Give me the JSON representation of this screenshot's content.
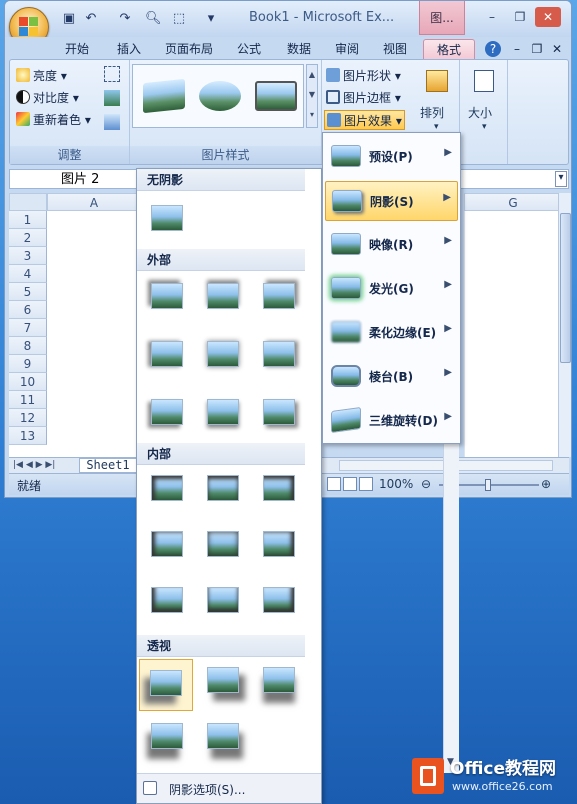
{
  "window": {
    "title": "Book1 - Microsoft Ex...",
    "context_tab": "图...",
    "min": "–",
    "restore": "❐",
    "close": "✕"
  },
  "tabs": [
    "开始",
    "插入",
    "页面布局",
    "公式",
    "数据",
    "审阅",
    "视图",
    "格式"
  ],
  "ribbon": {
    "adjust": {
      "items": [
        "亮度",
        "对比度",
        "重新着色"
      ],
      "label": "调整"
    },
    "styles": {
      "label": "图片样式"
    },
    "picture": {
      "shape": "图片形状",
      "border": "图片边框",
      "effects": "图片效果"
    },
    "arrange": {
      "label": "排列"
    },
    "size": {
      "label": "大小"
    }
  },
  "namebox": "图片 2",
  "grid": {
    "col_a": "A",
    "col_g": "G",
    "rows": [
      "1",
      "2",
      "3",
      "4",
      "5",
      "6",
      "7",
      "8",
      "9",
      "10",
      "11",
      "12",
      "13"
    ]
  },
  "sheet_tab": "Sheet1",
  "status": {
    "ready": "就绪",
    "zoom": "100%"
  },
  "shadow_panel": {
    "sections": [
      "无阴影",
      "外部",
      "内部",
      "透视"
    ],
    "footer": "阴影选项(S)..."
  },
  "effects_menu": [
    {
      "label": "预设(P)"
    },
    {
      "label": "阴影(S)",
      "highlighted": true
    },
    {
      "label": "映像(R)"
    },
    {
      "label": "发光(G)"
    },
    {
      "label": "柔化边缘(E)"
    },
    {
      "label": "棱台(B)"
    },
    {
      "label": "三维旋转(D)"
    }
  ],
  "watermark": {
    "brand": "Office教程网",
    "url": "www.office26.com"
  },
  "colors": {
    "accent": "#ffd66a",
    "context": "#e7a7b8",
    "ribbon": "#d5e4f6"
  }
}
